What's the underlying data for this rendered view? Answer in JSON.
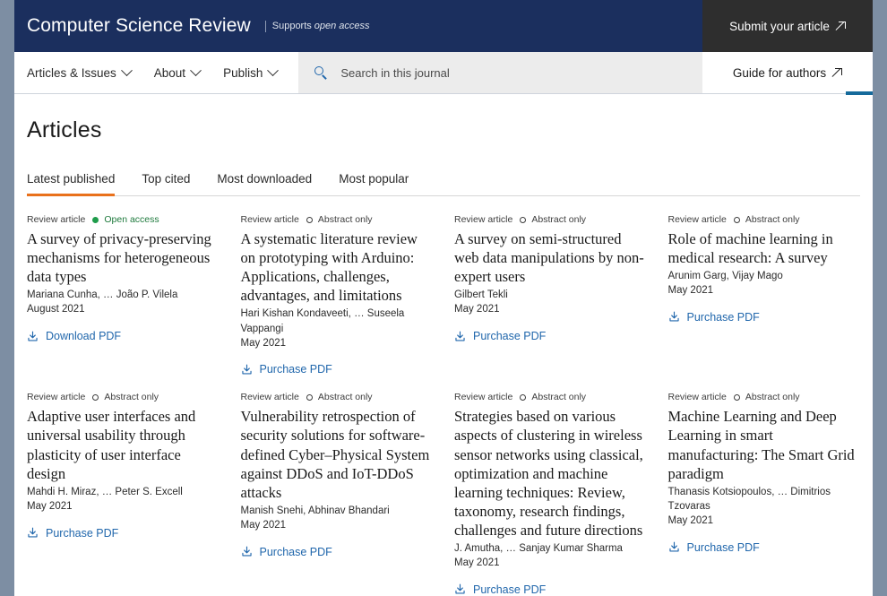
{
  "header": {
    "journal_title": "Computer Science Review",
    "supports_prefix": "Supports",
    "supports_emphasis": "open access",
    "submit_label": "Submit your article",
    "submit_icon": "external-link-arrow-icon",
    "background_color": "#1b2f5e",
    "submit_button_color": "#2e2e2e"
  },
  "nav": {
    "items": [
      {
        "label": "Articles & Issues",
        "icon": "chevron-down-icon"
      },
      {
        "label": "About",
        "icon": "chevron-down-icon"
      },
      {
        "label": "Publish",
        "icon": "chevron-down-icon"
      }
    ],
    "search": {
      "icon": "search-icon",
      "placeholder": "Search in this journal",
      "value": ""
    },
    "guide_label": "Guide for authors",
    "guide_icon": "external-link-arrow-icon",
    "accent_color": "#156a9b"
  },
  "main": {
    "page_title": "Articles",
    "tabs": [
      {
        "label": "Latest published",
        "active": true
      },
      {
        "label": "Top cited",
        "active": false
      },
      {
        "label": "Most downloaded",
        "active": false
      },
      {
        "label": "Most popular",
        "active": false
      }
    ],
    "active_tab_color": "#e9711c"
  },
  "articles": [
    {
      "type": "Review article",
      "access": "Open access",
      "access_state": "open",
      "title": "A survey of privacy-preserving mechanisms for heterogeneous data types",
      "authors": "Mariana Cunha, … João P. Vilela",
      "date": "August 2021",
      "pdf_label": "Download PDF",
      "pdf_icon": "download-icon"
    },
    {
      "type": "Review article",
      "access": "Abstract only",
      "access_state": "closed",
      "title": "A systematic literature review on prototyping with Arduino: Applications, challenges, advantages, and limitations",
      "authors": "Hari Kishan Kondaveeti, … Suseela Vappangi",
      "date": "May 2021",
      "pdf_label": "Purchase PDF",
      "pdf_icon": "download-icon"
    },
    {
      "type": "Review article",
      "access": "Abstract only",
      "access_state": "closed",
      "title": "A survey on semi-structured web data manipulations by non-expert users",
      "authors": "Gilbert Tekli",
      "date": "May 2021",
      "pdf_label": "Purchase PDF",
      "pdf_icon": "download-icon"
    },
    {
      "type": "Review article",
      "access": "Abstract only",
      "access_state": "closed",
      "title": "Role of machine learning in medical research: A survey",
      "authors": "Arunim Garg, Vijay Mago",
      "date": "May 2021",
      "pdf_label": "Purchase PDF",
      "pdf_icon": "download-icon"
    },
    {
      "type": "Review article",
      "access": "Abstract only",
      "access_state": "closed",
      "title": "Adaptive user interfaces and universal usability through plasticity of user interface design",
      "authors": "Mahdi H. Miraz, … Peter S. Excell",
      "date": "May 2021",
      "pdf_label": "Purchase PDF",
      "pdf_icon": "download-icon"
    },
    {
      "type": "Review article",
      "access": "Abstract only",
      "access_state": "closed",
      "title": "Vulnerability retrospection of security solutions for software-defined Cyber–Physical System against DDoS and IoT-DDoS attacks",
      "authors": "Manish Snehi, Abhinav Bhandari",
      "date": "May 2021",
      "pdf_label": "Purchase PDF",
      "pdf_icon": "download-icon"
    },
    {
      "type": "Review article",
      "access": "Abstract only",
      "access_state": "closed",
      "title": "Strategies based on various aspects of clustering in wireless sensor networks using classical, optimization and machine learning techniques: Review, taxonomy, research findings, challenges and future directions",
      "authors": "J. Amutha, … Sanjay Kumar Sharma",
      "date": "May 2021",
      "pdf_label": "Purchase PDF",
      "pdf_icon": "download-icon"
    },
    {
      "type": "Review article",
      "access": "Abstract only",
      "access_state": "closed",
      "title": "Machine Learning and Deep Learning in smart manufacturing: The Smart Grid paradigm",
      "authors": "Thanasis Kotsiopoulos, … Dimitrios Tzovaras",
      "date": "May 2021",
      "pdf_label": "Purchase PDF",
      "pdf_icon": "download-icon"
    }
  ]
}
